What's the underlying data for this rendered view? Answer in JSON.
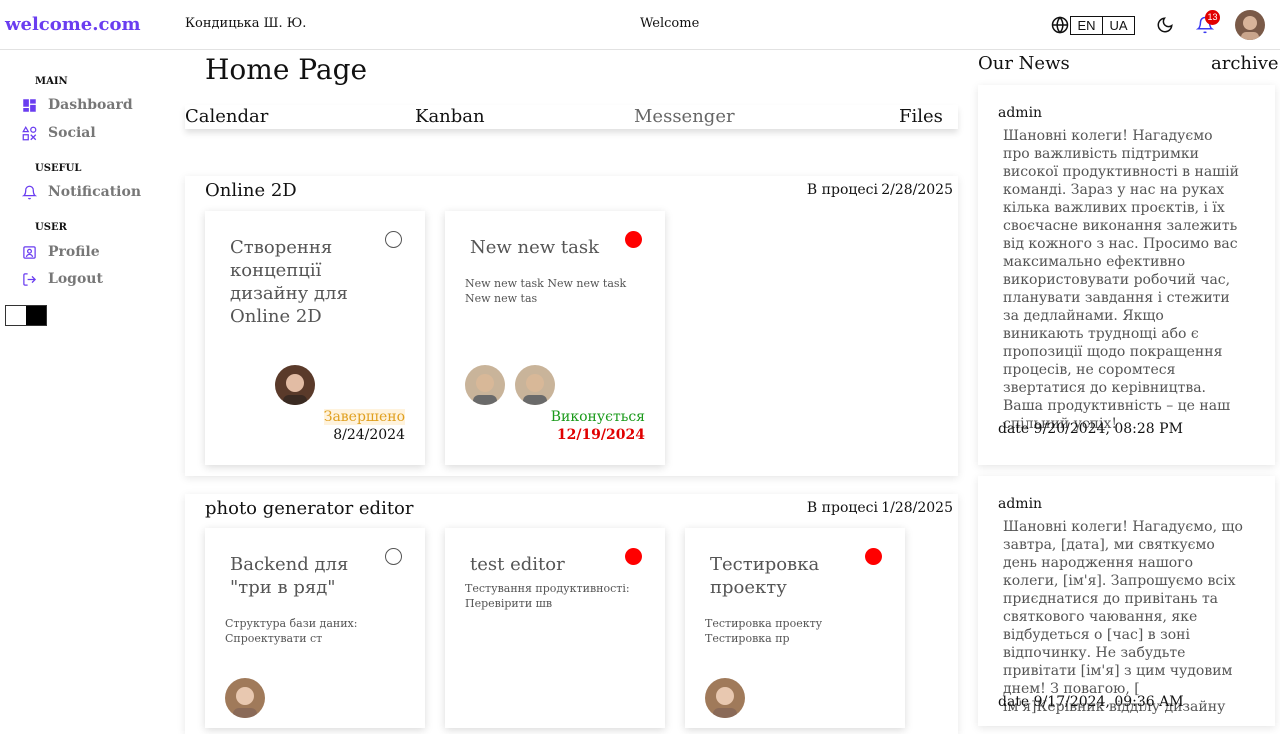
{
  "header": {
    "logo": "welcome.com",
    "user_name": "Кондицька Ш. Ю.",
    "welcome": "Welcome",
    "lang_en": "EN",
    "lang_ua": "UA",
    "notifications_count": "13",
    "accent_color": "#6a3df0"
  },
  "sidebar": {
    "sections": [
      {
        "title": "MAIN",
        "items": [
          {
            "label": "Dashboard",
            "icon": "dashboard-icon"
          },
          {
            "label": "Social",
            "icon": "social-icon"
          }
        ]
      },
      {
        "title": "USEFUL",
        "items": [
          {
            "label": "Notification",
            "icon": "bell-icon"
          }
        ]
      },
      {
        "title": "USER",
        "items": [
          {
            "label": "Profile",
            "icon": "profile-icon"
          },
          {
            "label": "Logout",
            "icon": "logout-icon"
          }
        ]
      }
    ]
  },
  "main": {
    "title": "Home Page",
    "tabs": [
      "Calendar",
      "Kanban",
      "Messenger",
      "Files"
    ],
    "projects": [
      {
        "title": "Online 2D",
        "status": "В процесі",
        "date": "2/28/2025",
        "cards": [
          {
            "title": "Створення концепції дизайну для Online 2D",
            "desc": "",
            "dot": "empty",
            "status": "Завершено",
            "date": "8/24/2024"
          },
          {
            "title": "New new task",
            "desc": "New new task New new task New new tas",
            "dot": "red",
            "status": "Виконується",
            "date": "12/19/2024"
          }
        ]
      },
      {
        "title": "photo generator editor",
        "status": "В процесі",
        "date": "1/28/2025",
        "cards": [
          {
            "title": "Backend для \"три в ряд\"",
            "desc": "Структура бази даних: Спроектувати ст",
            "dot": "empty"
          },
          {
            "title": "test editor",
            "desc": "Тестування продуктивності: Перевірити шв",
            "dot": "red"
          },
          {
            "title": "Тестировка проекту",
            "desc": "Тестировка проекту Тестировка пр",
            "dot": "red"
          }
        ]
      }
    ]
  },
  "news": {
    "heading": "Our News",
    "archive": "archive",
    "items": [
      {
        "author": "admin",
        "text": "Шановні колеги! Нагадуємо про важливість підтримки високої продуктивності в нашій команді. Зараз у нас на руках кілька важливих проєктів, і їх своєчасне виконання залежить від кожного з нас. Просимо вас максимально ефективно використовувати робочий час, планувати завдання і стежити за дедлайнами. Якщо виникають труднощі або є пропозиції щодо покращення процесів, не соромтеся звертатися до керівництва. Ваша продуктивність – це наш спільний успіх!",
        "date": "date 9/20/2024, 08:28 PM"
      },
      {
        "author": "admin",
        "text": "Шановні колеги! Нагадуємо, що завтра, [дата], ми святкуємо день народження нашого колеги, [ім'я]. Запрошуємо всіх приєднатися до привітань та святкового чаювання, яке відбудеться о [час] в зоні відпочинку. Не забудьте привітати [ім'я] з цим чудовим днем! З повагою, [ ім'я]Керівник відділу дизайну",
        "date": "date 9/17/2024, 09:36 AM"
      }
    ]
  }
}
